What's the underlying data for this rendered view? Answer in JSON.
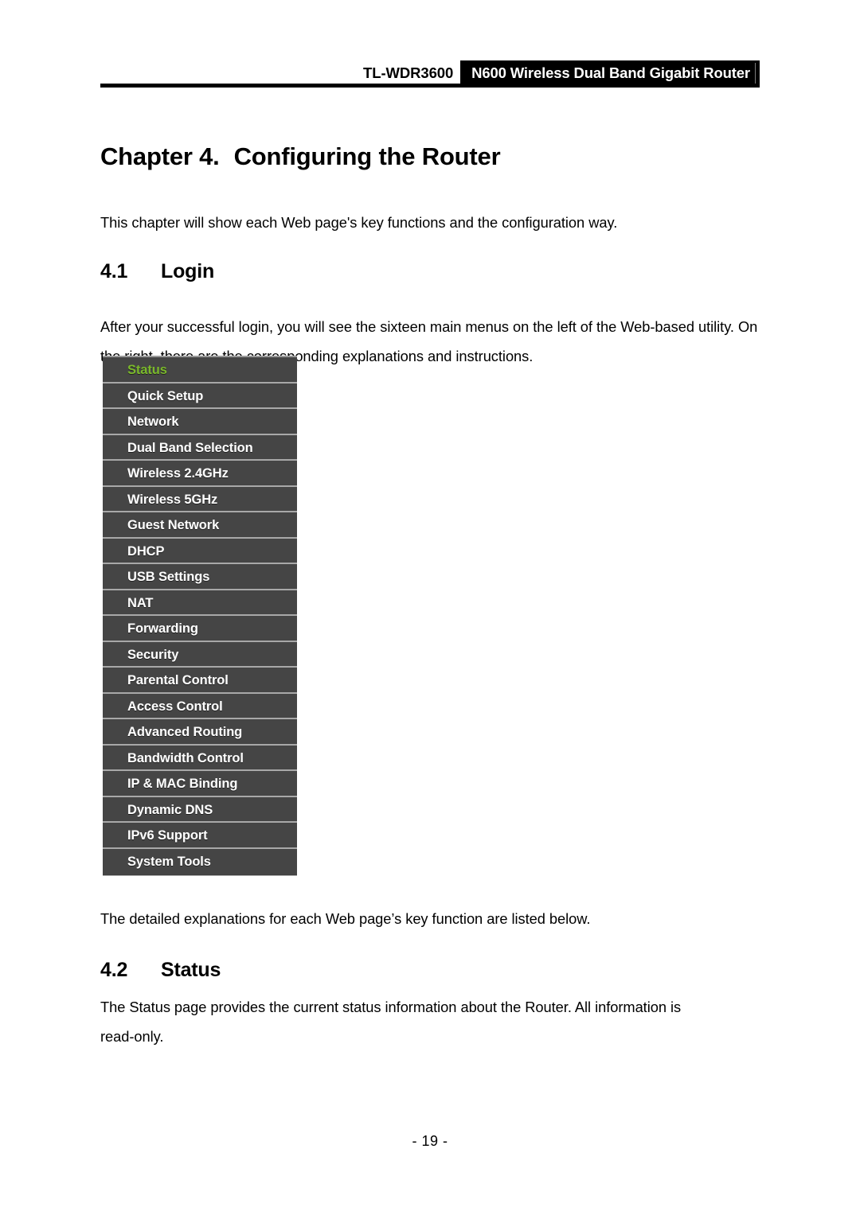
{
  "header": {
    "model": "TL-WDR3600",
    "product": "N600 Wireless Dual Band Gigabit Router"
  },
  "chapter": {
    "number": "Chapter 4.",
    "title": "Configuring the Router"
  },
  "intro_paragraph": "This chapter will show each Web page's key functions and the configuration way.",
  "sections": [
    {
      "number": "4.1",
      "title": "Login",
      "paragraph": "After your successful login, you will see the sixteen main menus on the left of the Web-based utility. On the right, there are the corresponding explanations and instructions.",
      "after_figure_paragraph": "The detailed explanations for each Web page’s key function are listed below."
    },
    {
      "number": "4.2",
      "title": "Status",
      "paragraph": "The Status page provides the current status information about the Router. All information is",
      "paragraph_last_line": "read-only."
    }
  ],
  "router_menu": {
    "active_color": "#7ab82b",
    "background_color": "#454545",
    "divider_color": "#a8a8a8",
    "items": [
      {
        "label": "Status",
        "active": true
      },
      {
        "label": "Quick Setup",
        "active": false
      },
      {
        "label": "Network",
        "active": false
      },
      {
        "label": "Dual Band Selection",
        "active": false
      },
      {
        "label": "Wireless 2.4GHz",
        "active": false
      },
      {
        "label": "Wireless 5GHz",
        "active": false
      },
      {
        "label": "Guest Network",
        "active": false
      },
      {
        "label": "DHCP",
        "active": false
      },
      {
        "label": "USB Settings",
        "active": false
      },
      {
        "label": "NAT",
        "active": false
      },
      {
        "label": "Forwarding",
        "active": false
      },
      {
        "label": "Security",
        "active": false
      },
      {
        "label": "Parental Control",
        "active": false
      },
      {
        "label": "Access Control",
        "active": false
      },
      {
        "label": "Advanced Routing",
        "active": false
      },
      {
        "label": "Bandwidth Control",
        "active": false
      },
      {
        "label": "IP & MAC Binding",
        "active": false
      },
      {
        "label": "Dynamic DNS",
        "active": false
      },
      {
        "label": "IPv6 Support",
        "active": false
      },
      {
        "label": "System Tools",
        "active": false
      }
    ]
  },
  "footer": {
    "page_number": "- 19 -"
  }
}
